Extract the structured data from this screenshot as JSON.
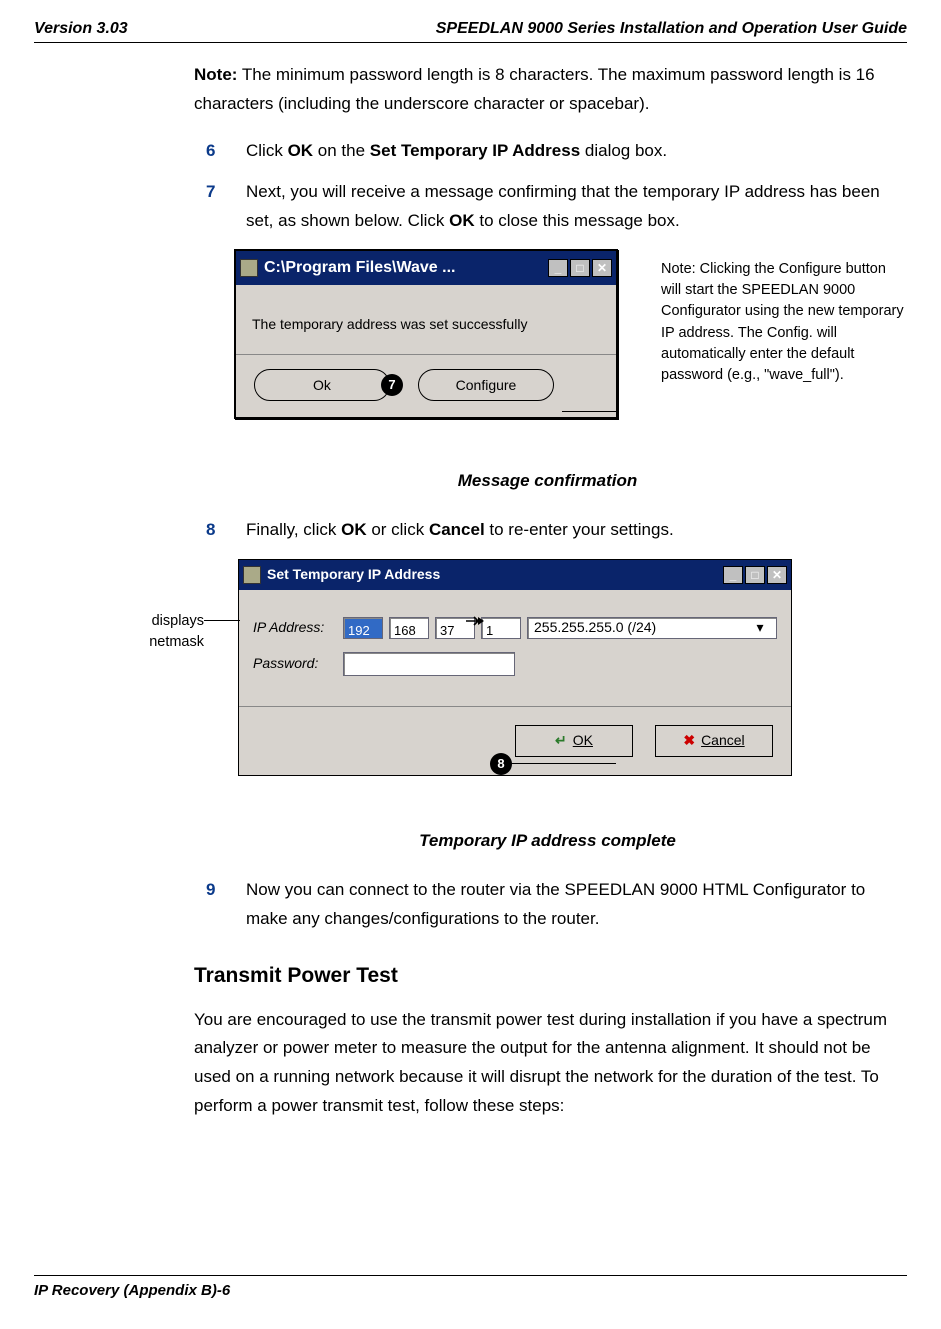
{
  "header": {
    "left": "Version 3.03",
    "right": "SPEEDLAN 9000 Series Installation and Operation User Guide"
  },
  "note_line_a": "Note:",
  "note_line_b": " The minimum password length is 8 characters. The maximum password length is 16 characters (including the underscore character or spacebar).",
  "steps": {
    "s6": {
      "num": "6",
      "pre": "Click ",
      "b1": "OK",
      "mid1": " on the ",
      "b2": "Set Temporary IP Address",
      "post": " dialog box."
    },
    "s7": {
      "num": "7",
      "pre": "Next, you will receive a message confirming that the temporary IP address has been set, as shown below. Click ",
      "b1": "OK",
      "post": " to close this message box."
    },
    "s8": {
      "num": "8",
      "pre": "Finally, click ",
      "b1": "OK",
      "mid1": " or click ",
      "b2": "Cancel",
      "post": " to re-enter your settings."
    },
    "s9": {
      "num": "9",
      "text": "Now you can connect to the router via the SPEEDLAN 9000 HTML Configurator to make any changes/configurations to the router."
    }
  },
  "dlg1": {
    "title": "C:\\Program Files\\Wave ...",
    "msg": "The  temporary address was set successfully",
    "btn_ok": "Ok",
    "btn_configure": "Configure",
    "badge": "7",
    "sidenote": "Note: Clicking the Configure button will start the SPEEDLAN 9000 Configurator using the new temporary IP address. The Config. will automatically enter the default password (e.g., \"wave_full\")."
  },
  "caption1": "Message confirmation",
  "dlg2": {
    "title": "Set Temporary IP Address",
    "lbl_ip": "IP Address:",
    "lbl_pw": "Password:",
    "ip": [
      "192",
      "168",
      "37",
      "1"
    ],
    "netmask": "255.255.255.0 (/24)",
    "btn_ok": "OK",
    "btn_cancel": "Cancel",
    "badge": "8",
    "sidenote": "displays netmask"
  },
  "caption2": "Temporary IP address complete",
  "section_heading": "Transmit Power Test",
  "section_body": "You are encouraged to use the transmit power test during installation if you have a spectrum analyzer or power meter to measure the output for the antenna alignment. It should not be used on a running network because it will disrupt the network for the duration of the test. To perform a power transmit test, follow these steps:",
  "footer": "IP Recovery (Appendix B)-6"
}
